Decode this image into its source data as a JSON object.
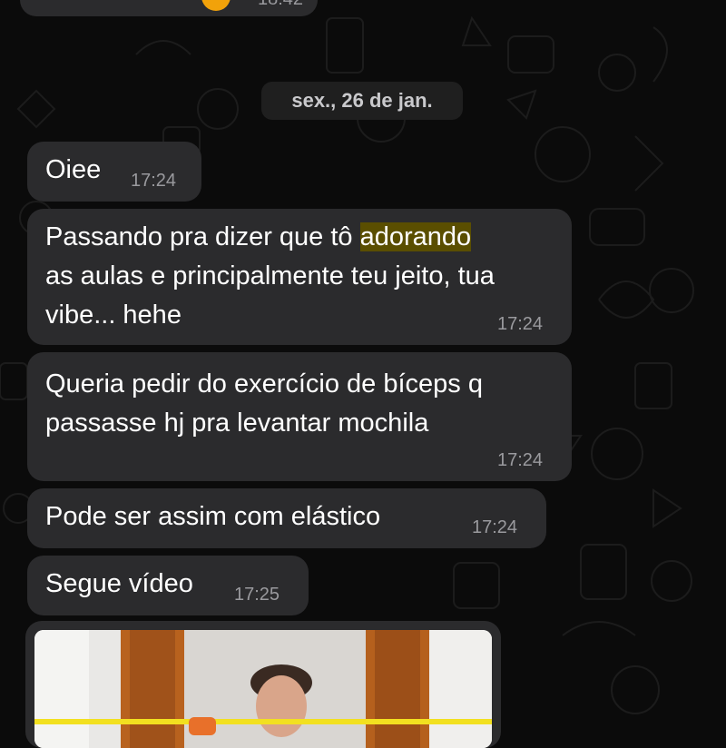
{
  "chat": {
    "previous_message_time": "18:42",
    "date_separator": "sex., 26 de jan.",
    "messages": [
      {
        "time": "17:24",
        "text": "Oiee"
      },
      {
        "time": "17:24",
        "line1_pre": "Passando pra dizer que tô ",
        "line1_highlight": "adorando",
        "line2": "as aulas e principalmente teu jeito, tua",
        "line3": "vibe... hehe"
      },
      {
        "time": "17:24",
        "line1": "Queria pedir do exercício de bíceps q",
        "line2": "passasse hj pra levantar mochila"
      },
      {
        "time": "17:24",
        "text": "Pode ser assim com elástico"
      },
      {
        "time": "17:25",
        "text": "Segue vídeo"
      }
    ],
    "video_message": {
      "kind": "video-thumbnail"
    }
  },
  "colors": {
    "background": "#0b0b0b",
    "bubble": "#2b2b2d",
    "text": "#ffffff",
    "time": "#9a9a9e",
    "highlight": "#5a4e00"
  },
  "icons": [
    "emoji-icon"
  ]
}
